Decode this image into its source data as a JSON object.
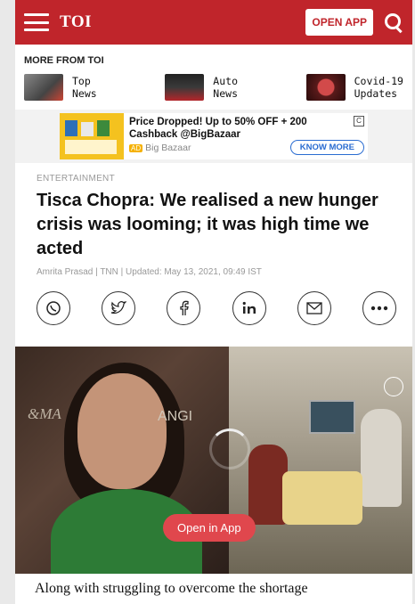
{
  "header": {
    "logo": "TOI",
    "open_app_label": "OPEN APP"
  },
  "more_from": {
    "title": "MORE FROM TOI",
    "items": [
      {
        "label": "Top\nNews"
      },
      {
        "label": "Auto\nNews"
      },
      {
        "label": "Covid-19\nUpdates"
      }
    ]
  },
  "ad": {
    "headline": "Price Dropped! Up to 50% OFF + 200 Cashback @BigBazaar",
    "advertiser": "Big Bazaar",
    "ad_badge": "AD",
    "cta": "KNOW MORE",
    "close_glyph": "C"
  },
  "article": {
    "section": "ENTERTAINMENT",
    "headline": "Tisca Chopra: We realised a new hunger crisis was looming; it was high time we acted",
    "byline": "Amrita Prasad | TNN | Updated: May 13, 2021, 09:49 IST",
    "share_icons": [
      "whatsapp-icon",
      "twitter-icon",
      "facebook-icon",
      "linkedin-icon",
      "email-icon",
      "more-icon"
    ],
    "body_start": "Along with struggling to overcome the shortage"
  },
  "video": {
    "open_in_app": "Open in App",
    "watermark_left": "&MA",
    "watermark_right": "ANGI"
  },
  "colors": {
    "brand": "#c0252b",
    "cta_pill": "#e0474d",
    "ad_link": "#2a6cd1"
  }
}
